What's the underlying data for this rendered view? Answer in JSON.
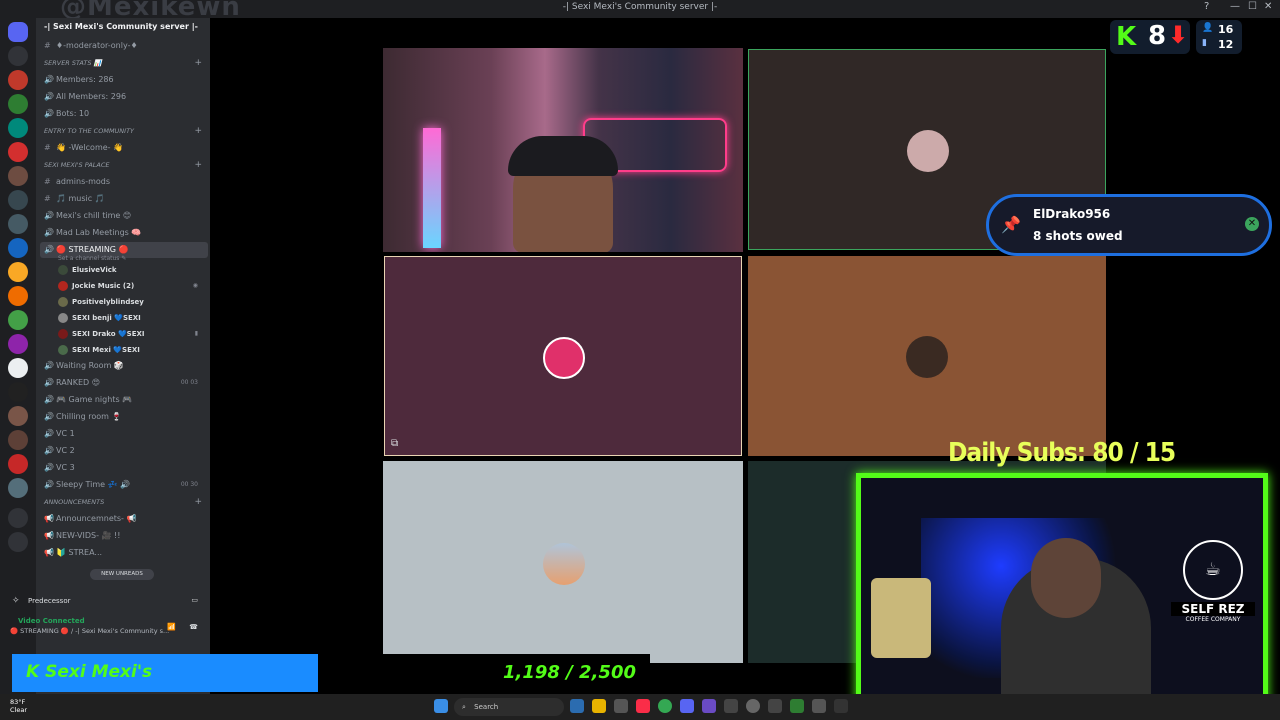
{
  "window": {
    "title": "-| Sexi Mexi's Community server |-",
    "handle": "@Mexikewn",
    "controls": [
      "?",
      "—",
      "☐",
      "✕"
    ]
  },
  "sidebar": {
    "server_name": "-| Sexi Mexi's Community server |-",
    "rows": [
      {
        "type": "channel",
        "icon": "#",
        "label": "♦-moderator-only-♦"
      },
      {
        "type": "category",
        "label": "SERVER STATS 📊"
      },
      {
        "type": "channel",
        "icon": "🔊",
        "label": "Members: 286"
      },
      {
        "type": "channel",
        "icon": "🔊",
        "label": "All Members: 296"
      },
      {
        "type": "channel",
        "icon": "🔊",
        "label": "Bots: 10"
      },
      {
        "type": "category",
        "label": "ENTRY TO THE COMMUNITY"
      },
      {
        "type": "channel",
        "icon": "#",
        "label": "👋 -Welcome- 👋"
      },
      {
        "type": "category",
        "label": "SEXI MEXI'S PALACE"
      },
      {
        "type": "channel",
        "icon": "#",
        "label": "admins-mods"
      },
      {
        "type": "channel",
        "icon": "#",
        "label": "🎵 music 🎵"
      },
      {
        "type": "channel",
        "icon": "🔊",
        "label": "Mexi's chill time 😊"
      },
      {
        "type": "channel",
        "icon": "🔊",
        "label": "Mad Lab Meetings 🧠"
      },
      {
        "type": "active",
        "icon": "🔊",
        "label": "🔴 STREAMING 🔴",
        "sub": "Set a channel status ✎"
      },
      {
        "type": "user",
        "label": "ElusiveVick",
        "color": "#3b4a3a"
      },
      {
        "type": "user",
        "label": "Jockie Music (2)",
        "color": "#b3261e",
        "badge": "◉"
      },
      {
        "type": "user",
        "label": "Positivelyblindsey",
        "color": "#6a6a4a"
      },
      {
        "type": "user",
        "label": "SEXI benji 💙SEXI",
        "color": "#888888"
      },
      {
        "type": "user",
        "label": "SEXI Drako 💙SEXI",
        "color": "#7a1a1a",
        "badge": "▮"
      },
      {
        "type": "user",
        "label": "SEXI Mexi 💙SEXI",
        "color": "#4a6a4a"
      },
      {
        "type": "channel",
        "icon": "🔊",
        "label": "Waiting Room 🎲"
      },
      {
        "type": "channel",
        "icon": "🔊",
        "label": "RANKED 😍",
        "badge": "00 03"
      },
      {
        "type": "channel",
        "icon": "🔊",
        "label": "🎮 Game nights 🎮"
      },
      {
        "type": "channel",
        "icon": "🔊",
        "label": "Chilling room 🍷"
      },
      {
        "type": "channel",
        "icon": "🔊",
        "label": "VC 1"
      },
      {
        "type": "channel",
        "icon": "🔊",
        "label": "VC 2"
      },
      {
        "type": "channel",
        "icon": "🔊",
        "label": "VC 3"
      },
      {
        "type": "channel",
        "icon": "🔊",
        "label": "Sleepy Time 💤 🔊",
        "badge": "00 30"
      },
      {
        "type": "category",
        "label": "ANNOUNCEMENTS"
      },
      {
        "type": "channel",
        "icon": "📢",
        "label": "Announcemnets- 📢"
      },
      {
        "type": "channel",
        "icon": "📢",
        "label": "NEW-VIDS- 🎥 !!"
      },
      {
        "type": "channel",
        "icon": "📢",
        "label": "🔰 STREA..."
      }
    ],
    "new_unreads": "NEW UNREADS",
    "user_panel": "Predecessor",
    "voice_status": "Video Connected",
    "voice_channel": "🔴 STREAMING 🔴 / -| Sexi Mexi's Community s..."
  },
  "overlay": {
    "counter_letter": "K",
    "counter_value": "8",
    "counter_arrow": "⬇",
    "stat_top": "16",
    "stat_bottom": "12",
    "alert_name": "ElDrako956",
    "alert_message": "8 shots owed",
    "alert_close": "✕",
    "daily_subs": "Daily Subs:  80 / 15",
    "logo_brand": "SELF REZ",
    "logo_sub": "COFFEE COMPANY",
    "banner_name": "K  Sexi Mexi's",
    "goal": "1,198 / 2,500"
  },
  "taskbar": {
    "weather_temp": "83°F",
    "weather_desc": "Clear",
    "search_label": "Search"
  },
  "colors": {
    "accent_green": "#53fc18",
    "alert_border": "#1e6fe0",
    "banner_blue": "#1a8cff",
    "daily_subs": "#e8ff5a"
  }
}
